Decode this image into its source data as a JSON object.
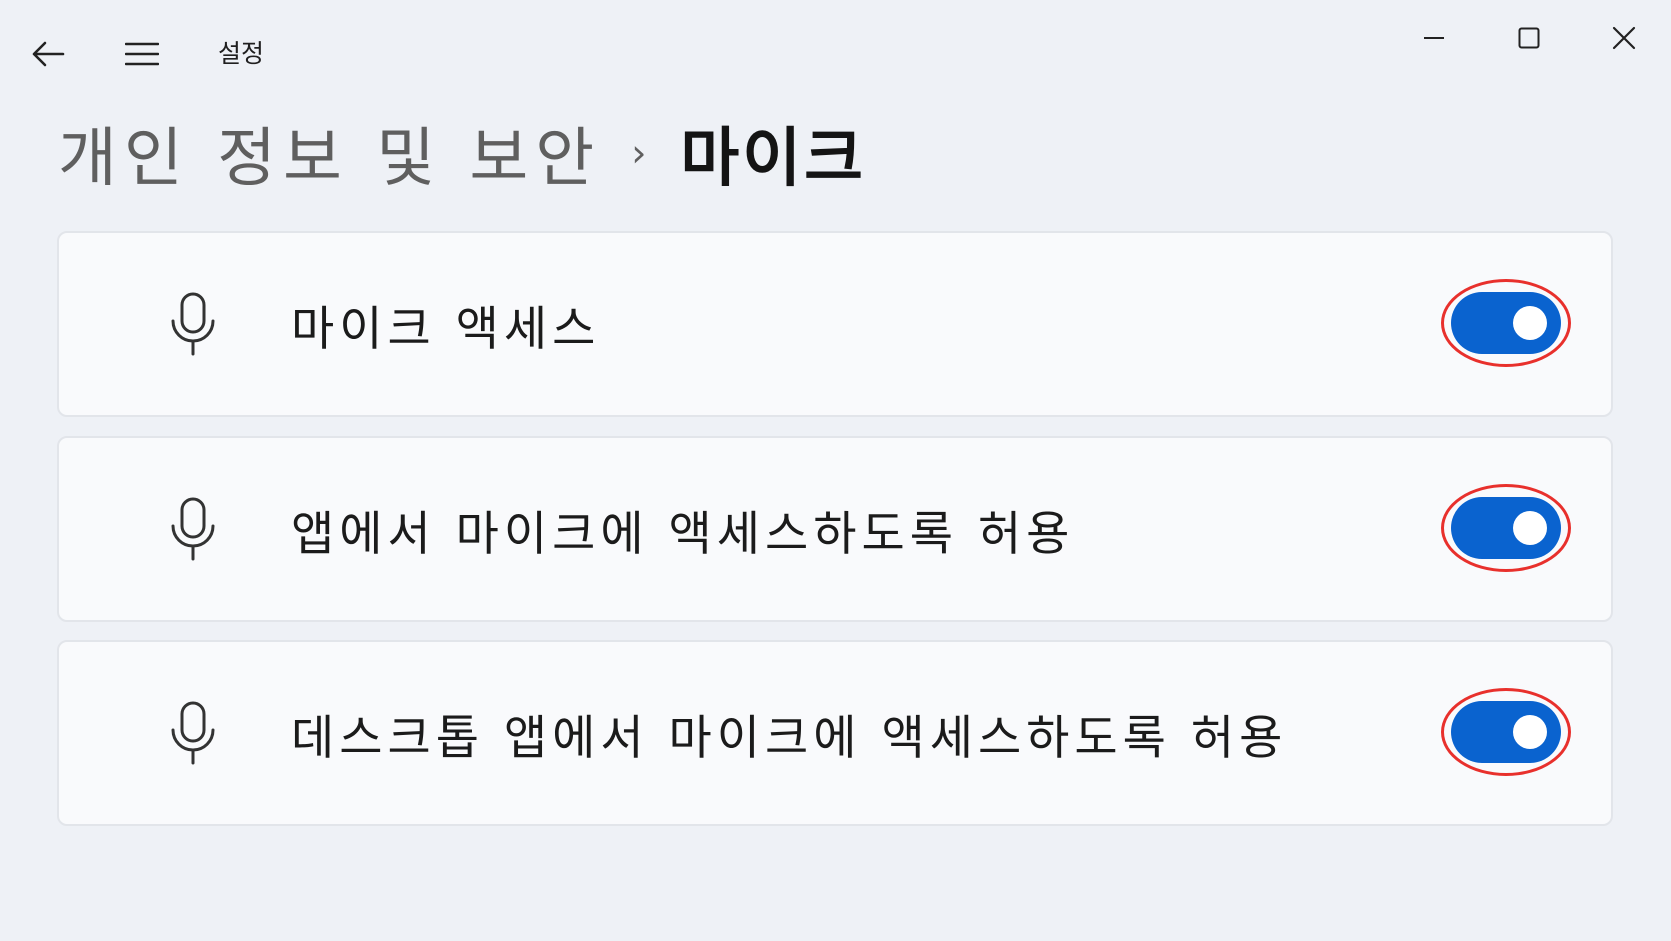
{
  "window": {
    "title": "설정",
    "icons": {
      "back": "back-arrow-icon",
      "menu": "hamburger-menu-icon",
      "minimize": "minimize-icon",
      "maximize": "maximize-icon",
      "close": "close-icon"
    }
  },
  "breadcrumb": {
    "parent": "개인 정보 및 보안",
    "separator": "›",
    "current": "마이크"
  },
  "settings": [
    {
      "label": "마이크 액세스",
      "icon": "microphone-icon",
      "state": "on"
    },
    {
      "label": "앱에서 마이크에 액세스하도록 허용",
      "icon": "microphone-icon",
      "state": "on"
    },
    {
      "label": "데스크톱 앱에서 마이크에 액세스하도록 허용",
      "icon": "microphone-icon",
      "state": "on"
    }
  ],
  "colors": {
    "toggle_on": "#0a63cf",
    "highlight_ring": "#e8302c",
    "background": "#eef1f6",
    "card": "#f9fafc"
  }
}
